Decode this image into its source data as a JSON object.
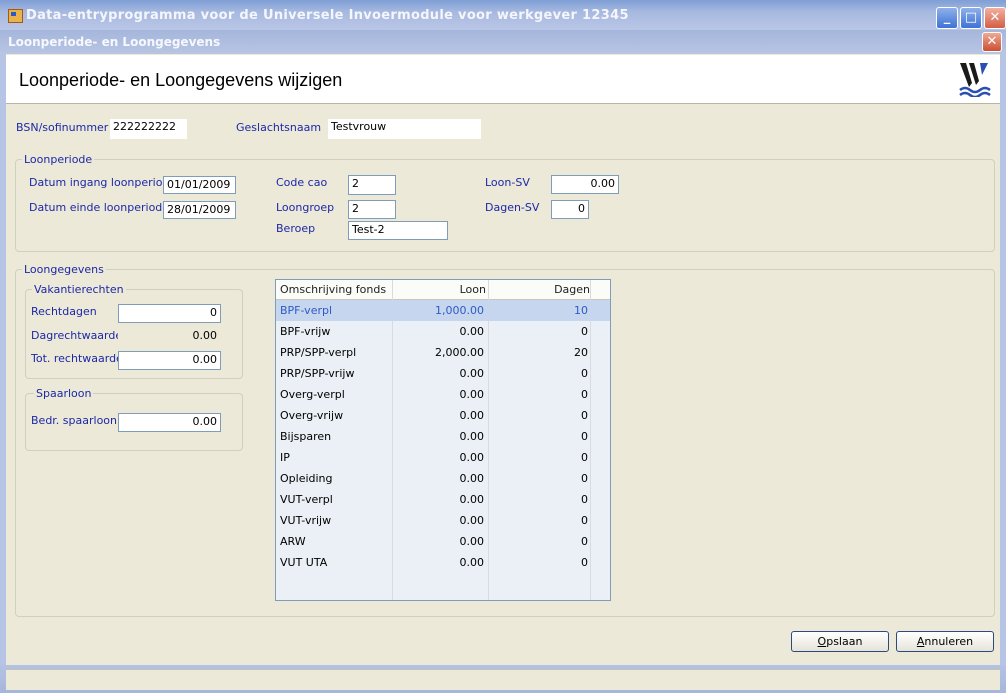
{
  "window": {
    "title": "Data-entryprogramma voor de Universele Invoermodule voor werkgever 12345",
    "minimize_glyph": "_",
    "maximize_glyph": "□",
    "close_glyph": "✕"
  },
  "dialog": {
    "title": "Loonperiode- en Loongegevens",
    "close_glyph": "✕",
    "header_title": "Loonperiode- en Loongegevens wijzigen"
  },
  "person": {
    "bsn_label": "BSN/sofinummer",
    "bsn_value": "222222222",
    "name_label": "Geslachtsnaam",
    "name_value": "Testvrouw"
  },
  "loonperiode": {
    "title": "Loonperiode",
    "start_label": "Datum ingang loonperiode",
    "start_value": "01/01/2009",
    "end_label": "Datum einde loonperiode",
    "end_value": "28/01/2009",
    "cao_label": "Code cao",
    "cao_value": "2",
    "loongroep_label": "Loongroep",
    "loongroep_value": "2",
    "beroep_label": "Beroep",
    "beroep_value": "Test-2",
    "loon_sv_label": "Loon-SV",
    "loon_sv_value": "0.00",
    "dagen_sv_label": "Dagen-SV",
    "dagen_sv_value": "0"
  },
  "loongegevens": {
    "title": "Loongegevens",
    "vakantie": {
      "title": "Vakantierechten",
      "rechtdagen_label": "Rechtdagen",
      "rechtdagen_value": "0",
      "dagrechtwaarde_label": "Dagrechtwaarde",
      "dagrechtwaarde_value": "0.00",
      "tot_label": "Tot. rechtwaarde",
      "tot_value": "0.00"
    },
    "spaarloon": {
      "title": "Spaarloon",
      "bedr_label": "Bedr. spaarloon",
      "bedr_value": "0.00"
    },
    "table": {
      "headers": [
        "Omschrijving fonds",
        "Loon",
        "Dagen"
      ],
      "rows": [
        {
          "fonds": "BPF-verpl",
          "loon": "1,000.00",
          "dagen": "10"
        },
        {
          "fonds": "BPF-vrijw",
          "loon": "0.00",
          "dagen": "0"
        },
        {
          "fonds": "PRP/SPP-verpl",
          "loon": "2,000.00",
          "dagen": "20"
        },
        {
          "fonds": "PRP/SPP-vrijw",
          "loon": "0.00",
          "dagen": "0"
        },
        {
          "fonds": "Overg-verpl",
          "loon": "0.00",
          "dagen": "0"
        },
        {
          "fonds": "Overg-vrijw",
          "loon": "0.00",
          "dagen": "0"
        },
        {
          "fonds": "Bijsparen",
          "loon": "0.00",
          "dagen": "0"
        },
        {
          "fonds": "IP",
          "loon": "0.00",
          "dagen": "0"
        },
        {
          "fonds": "Opleiding",
          "loon": "0.00",
          "dagen": "0"
        },
        {
          "fonds": "VUT-verpl",
          "loon": "0.00",
          "dagen": "0"
        },
        {
          "fonds": "VUT-vrijw",
          "loon": "0.00",
          "dagen": "0"
        },
        {
          "fonds": "ARW",
          "loon": "0.00",
          "dagen": "0"
        },
        {
          "fonds": "VUT UTA",
          "loon": "0.00",
          "dagen": "0"
        }
      ]
    }
  },
  "buttons": {
    "save_mnemonic": "O",
    "save_rest": "pslaan",
    "cancel_mnemonic": "A",
    "cancel_rest": "nnuleren"
  },
  "colors": {
    "label_blue": "#1c28a8",
    "selection": "#c5d6ee",
    "dialog_bg": "#ece9d8"
  },
  "icons": {
    "app": "app-icon",
    "logo": "company-logo"
  }
}
